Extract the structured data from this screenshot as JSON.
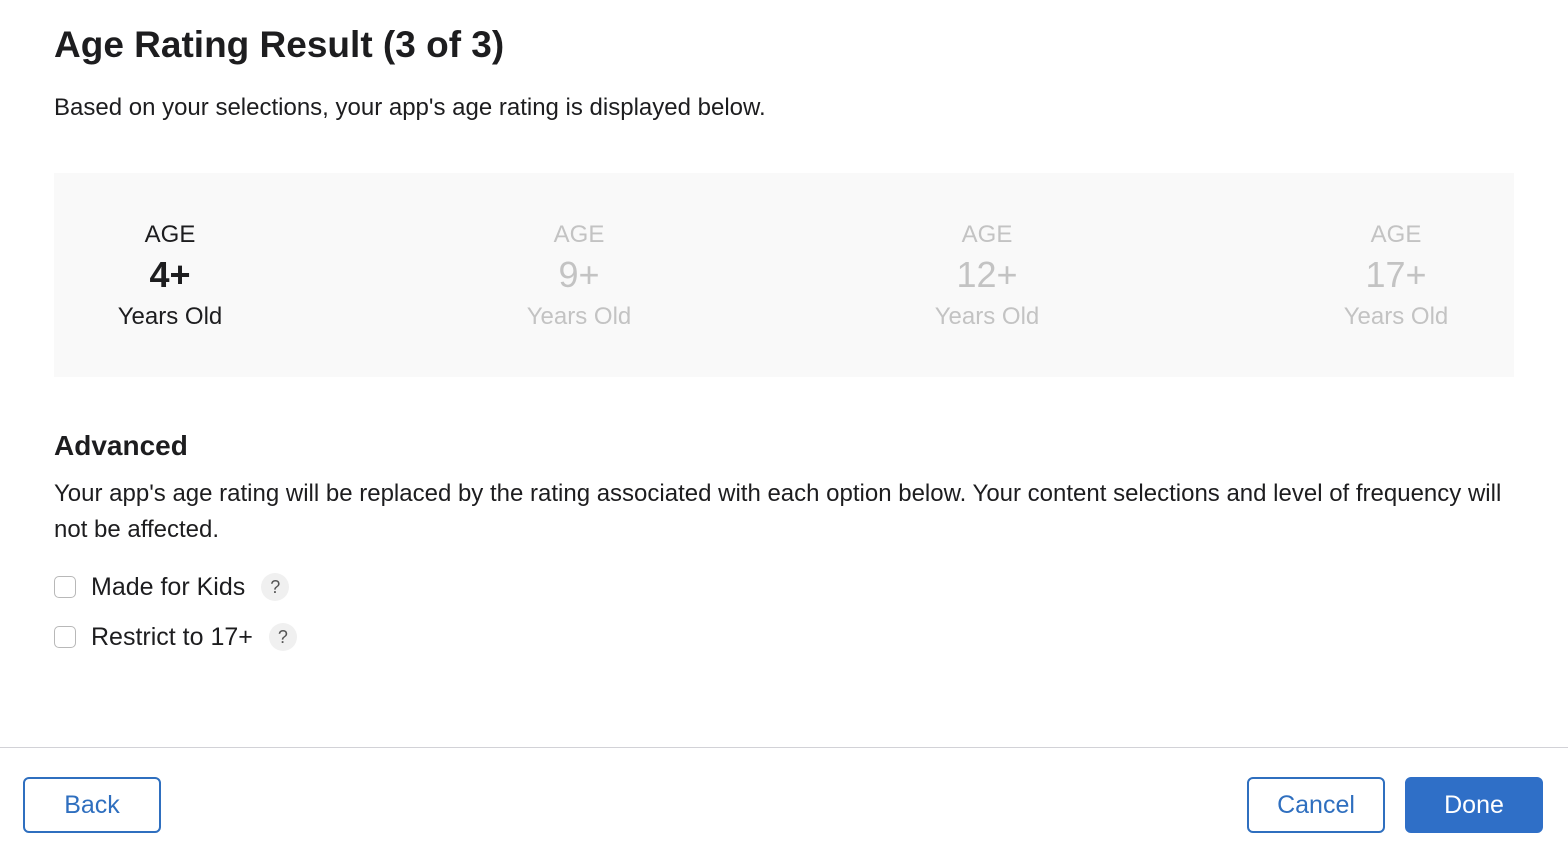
{
  "header": {
    "title": "Age Rating Result (3 of 3)",
    "subtitle": "Based on your selections, your app's age rating is displayed below."
  },
  "ratings": [
    {
      "label": "AGE",
      "value": "4+",
      "sub": "Years Old",
      "selected": true
    },
    {
      "label": "AGE",
      "value": "9+",
      "sub": "Years Old",
      "selected": false
    },
    {
      "label": "AGE",
      "value": "12+",
      "sub": "Years Old",
      "selected": false
    },
    {
      "label": "AGE",
      "value": "17+",
      "sub": "Years Old",
      "selected": false
    }
  ],
  "advanced": {
    "heading": "Advanced",
    "description": "Your app's age rating will be replaced by the rating associated with each option below. Your content selections and level of frequency will not be affected.",
    "options": [
      {
        "label": "Made for Kids",
        "checked": false,
        "help": "?"
      },
      {
        "label": "Restrict to 17+",
        "checked": false,
        "help": "?"
      }
    ]
  },
  "footer": {
    "back_label": "Back",
    "cancel_label": "Cancel",
    "done_label": "Done"
  },
  "colors": {
    "accent": "#2f6fc7",
    "selected_text": "#1d1d1f",
    "unselected_text": "#c3c3c3",
    "panel_bg": "#f9f9f9"
  },
  "icons": {
    "help": "question-mark-icon"
  }
}
